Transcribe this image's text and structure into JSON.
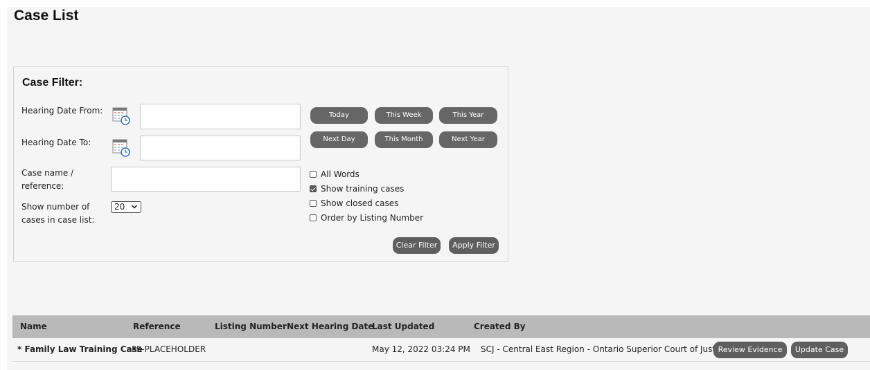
{
  "page": {
    "title": "Case List"
  },
  "filter": {
    "title": "Case Filter:",
    "hearing_from_label": "Hearing Date From:",
    "hearing_to_label": "Hearing Date To:",
    "case_name_label_1": "Case name /",
    "case_name_label_2": "reference:",
    "show_number_label_1": "Show number of",
    "show_number_label_2": "cases in case list:",
    "hearing_from_value": "",
    "hearing_to_value": "",
    "case_name_value": "",
    "show_number_value": "20",
    "quick_buttons": {
      "today": "Today",
      "this_week": "This Week",
      "this_year": "This Year",
      "next_day": "Next Day",
      "this_month": "This Month",
      "next_year": "Next Year"
    },
    "checkboxes": {
      "all_words": {
        "label": "All Words",
        "checked": false
      },
      "show_training": {
        "label": "Show training cases",
        "checked": true
      },
      "show_closed": {
        "label": "Show closed cases",
        "checked": false
      },
      "order_listing": {
        "label": "Order by Listing Number",
        "checked": false
      }
    },
    "clear_label": "Clear Filter",
    "apply_label": "Apply Filter"
  },
  "table": {
    "headers": [
      "Name",
      "Reference",
      "Listing Number",
      "Next Hearing Date",
      "Last Updated",
      "Created By"
    ],
    "rows": [
      {
        "name": "* Family Law Training Case",
        "reference": "FS-PLACEHOLDER",
        "listing_number": "",
        "next_hearing_date": "",
        "last_updated": "May 12, 2022 03:24 PM",
        "created_by": "SCJ - Central East Region - Ontario Superior Court of Justice",
        "review_label": "Review Evidence",
        "update_label": "Update Case"
      }
    ]
  },
  "colors": {
    "button_bg": "#666666",
    "table_header_bg": "#b9b9b9",
    "page_bg": "#f5f5f5"
  },
  "icons": {
    "calendar": "calendar-clock-icon",
    "dropdown": "chevron-down-icon"
  }
}
